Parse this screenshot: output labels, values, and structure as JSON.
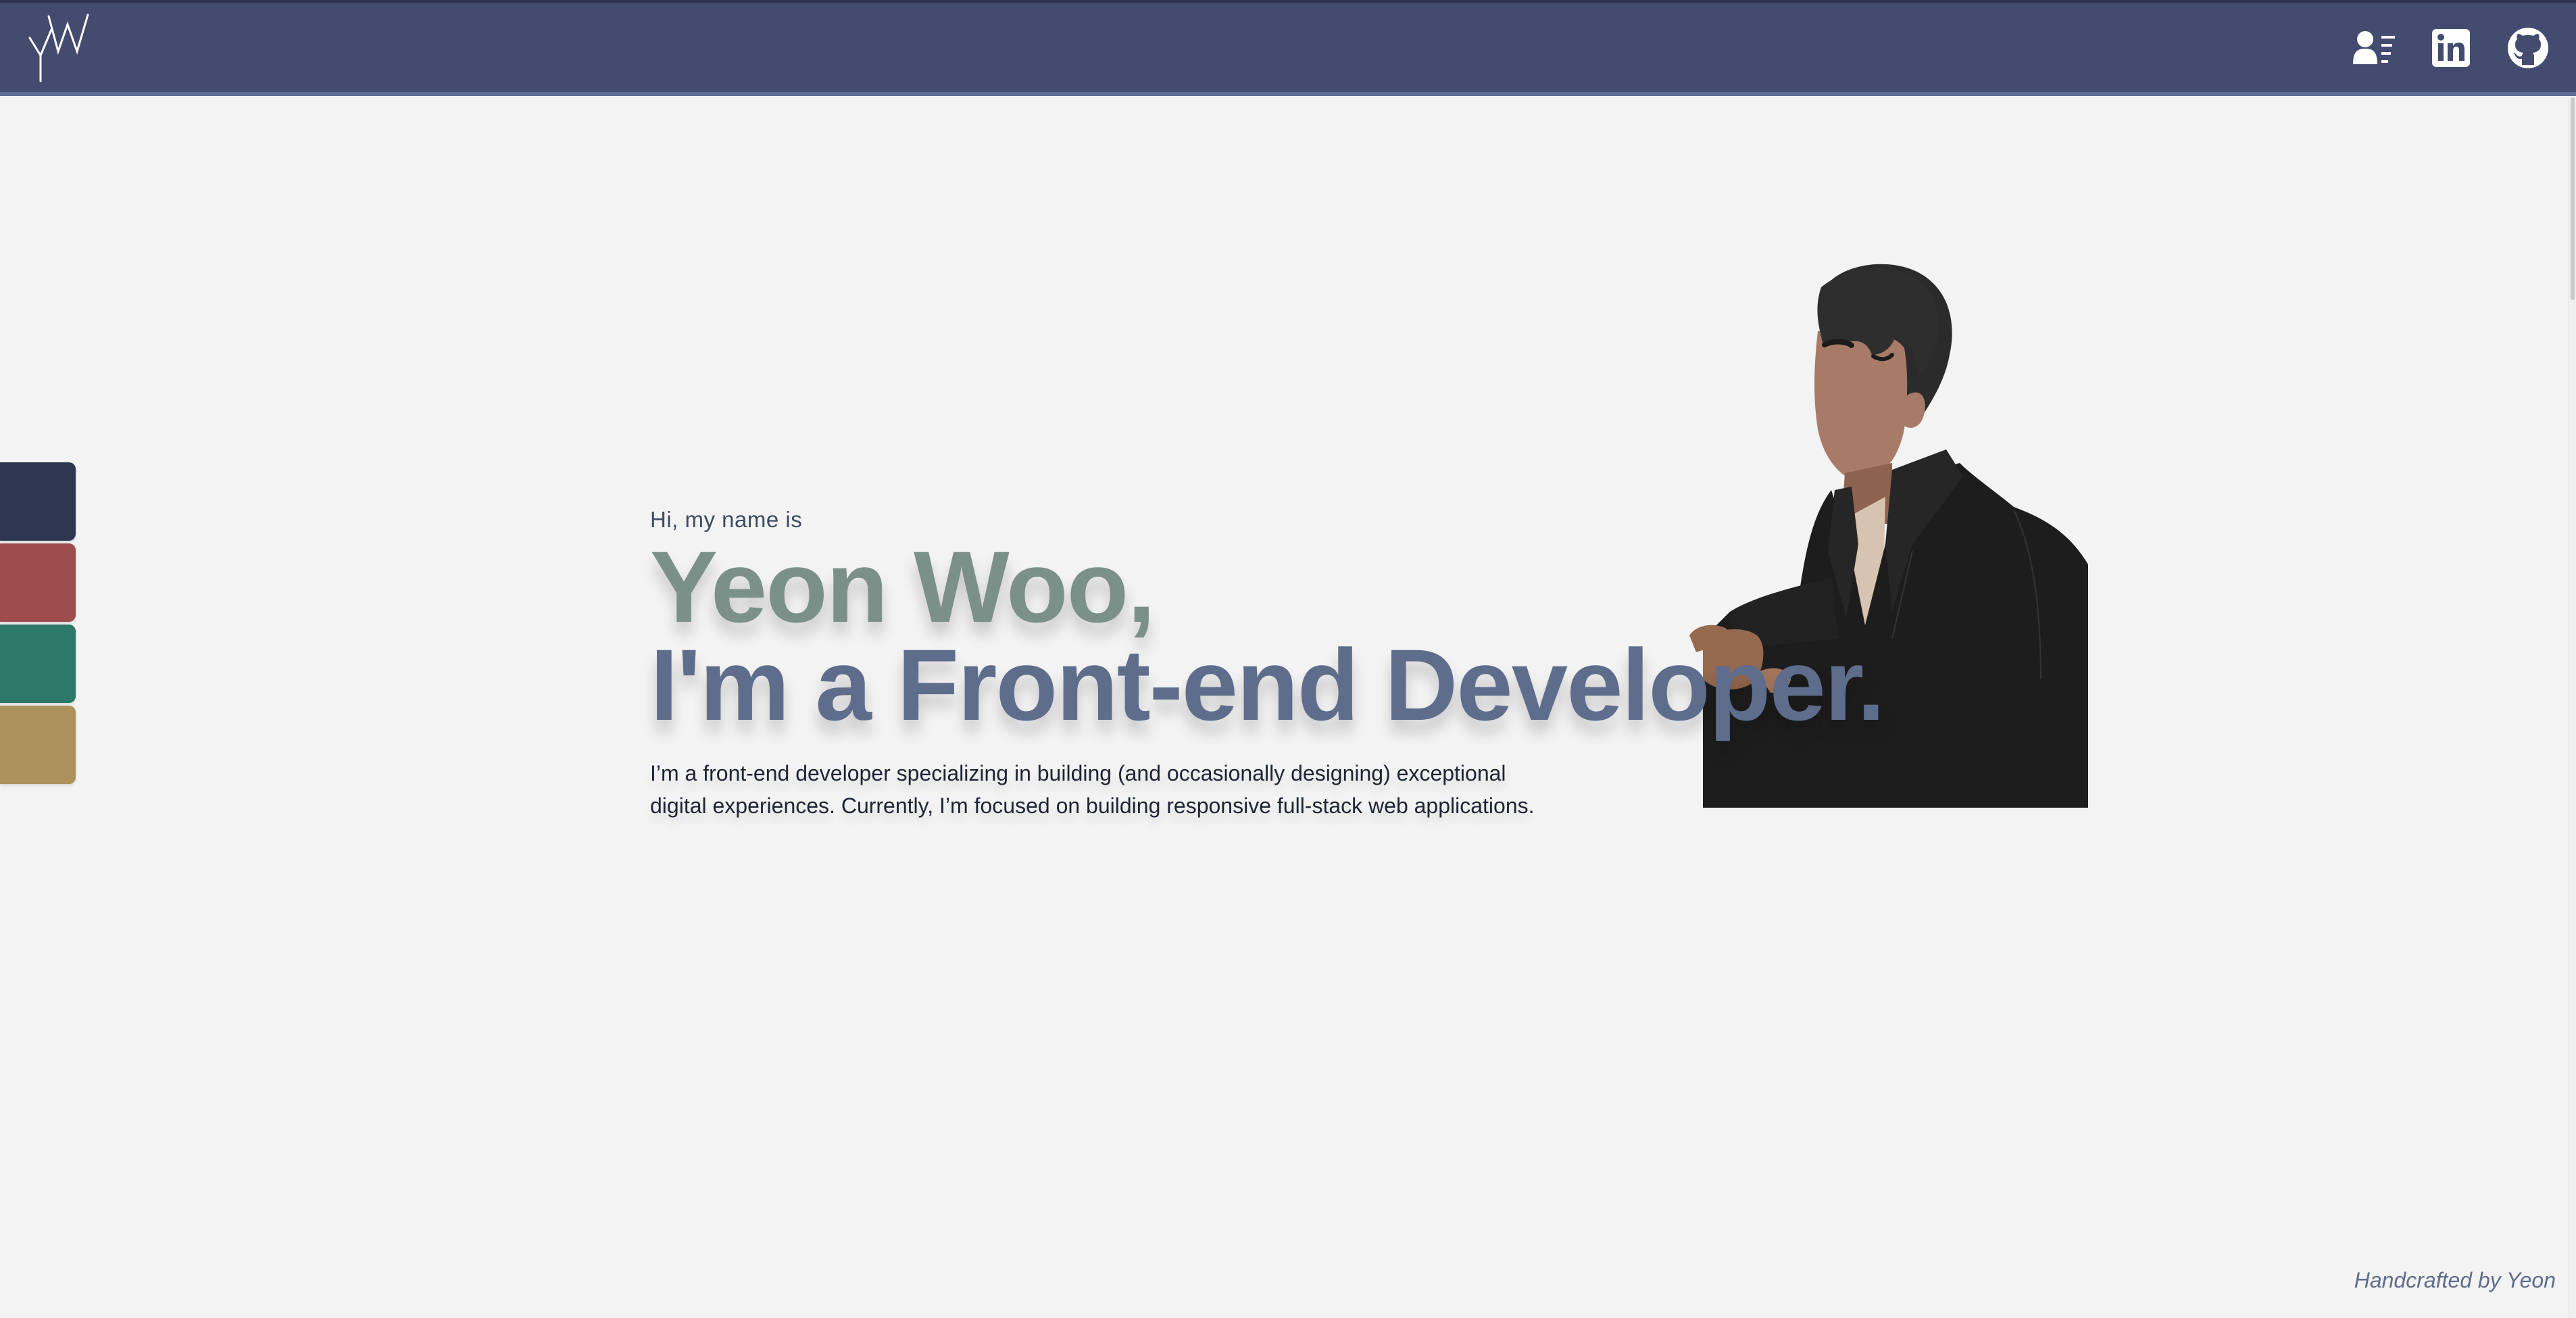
{
  "header": {
    "logo_letters": "YW",
    "icons": [
      {
        "name": "about-icon",
        "label": "About"
      },
      {
        "name": "linkedin-icon",
        "label": "LinkedIn"
      },
      {
        "name": "github-icon",
        "label": "GitHub"
      }
    ]
  },
  "theme_swatches": [
    {
      "name": "navy",
      "color": "#2e3650"
    },
    {
      "name": "red",
      "color": "#9c4d4c"
    },
    {
      "name": "green",
      "color": "#2d7868"
    },
    {
      "name": "gold",
      "color": "#ab925c"
    }
  ],
  "intro": {
    "greeting": "Hi, my name is",
    "name_line": "Yeon Woo,",
    "role_line": "I'm a Front-end Developer.",
    "description": "I’m a front-end developer specializing in building (and occasionally designing) exceptional digital experiences. Currently, I’m focused on building responsive full-stack web applications."
  },
  "footer": {
    "credit": "Handcrafted by Yeon"
  },
  "colors": {
    "header_bg": "#434b6f",
    "page_bg": "#f3f3f3",
    "name_color": "#7a9088",
    "role_color": "#5f6d8c"
  }
}
